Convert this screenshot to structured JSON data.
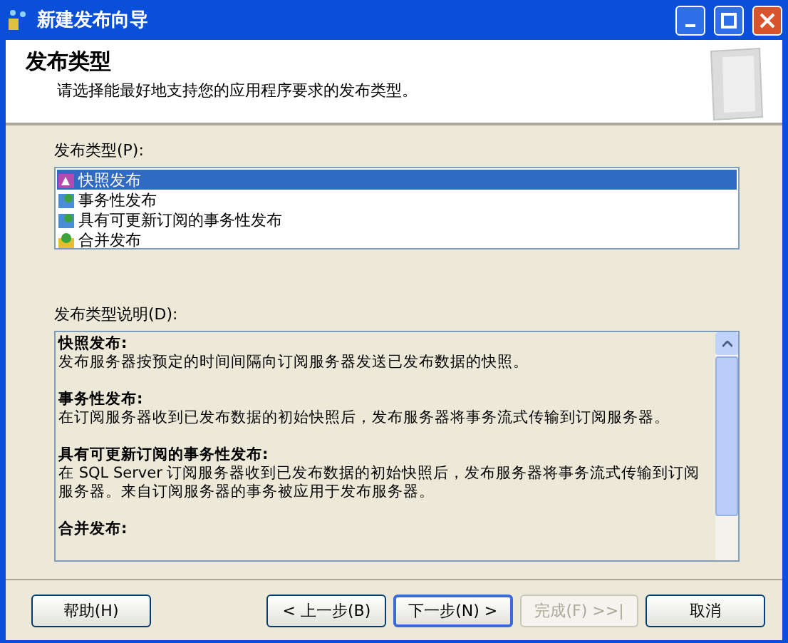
{
  "window": {
    "title": "新建发布向导"
  },
  "header": {
    "title": "发布类型",
    "subtitle": "请选择能最好地支持您的应用程序要求的发布类型。"
  },
  "type_list": {
    "label": "发布类型(P):",
    "items": [
      {
        "label": "快照发布",
        "kind": "snapshot",
        "selected": true
      },
      {
        "label": "事务性发布",
        "kind": "transactional",
        "selected": false
      },
      {
        "label": "具有可更新订阅的事务性发布",
        "kind": "transactional",
        "selected": false
      },
      {
        "label": "合并发布",
        "kind": "merge",
        "selected": false
      }
    ]
  },
  "description": {
    "label": "发布类型说明(D):",
    "sections": [
      {
        "heading": "快照发布:",
        "body": "发布服务器按预定的时间间隔向订阅服务器发送已发布数据的快照。"
      },
      {
        "heading": "事务性发布:",
        "body": "在订阅服务器收到已发布数据的初始快照后，发布服务器将事务流式传输到订阅服务器。"
      },
      {
        "heading": "具有可更新订阅的事务性发布:",
        "body": "在 SQL Server 订阅服务器收到已发布数据的初始快照后，发布服务器将事务流式传输到订阅服务器。来自订阅服务器的事务被应用于发布服务器。"
      },
      {
        "heading": "合并发布:"
      }
    ]
  },
  "buttons": [
    {
      "label": "帮助(H)",
      "default": false,
      "disabled": false
    },
    {
      "label": "< 上一步(B)",
      "default": false,
      "disabled": false
    },
    {
      "label": "下一步(N) >",
      "default": true,
      "disabled": false
    },
    {
      "label": "完成(F) >>|",
      "default": false,
      "disabled": true
    },
    {
      "label": "取消",
      "default": false,
      "disabled": false
    }
  ]
}
